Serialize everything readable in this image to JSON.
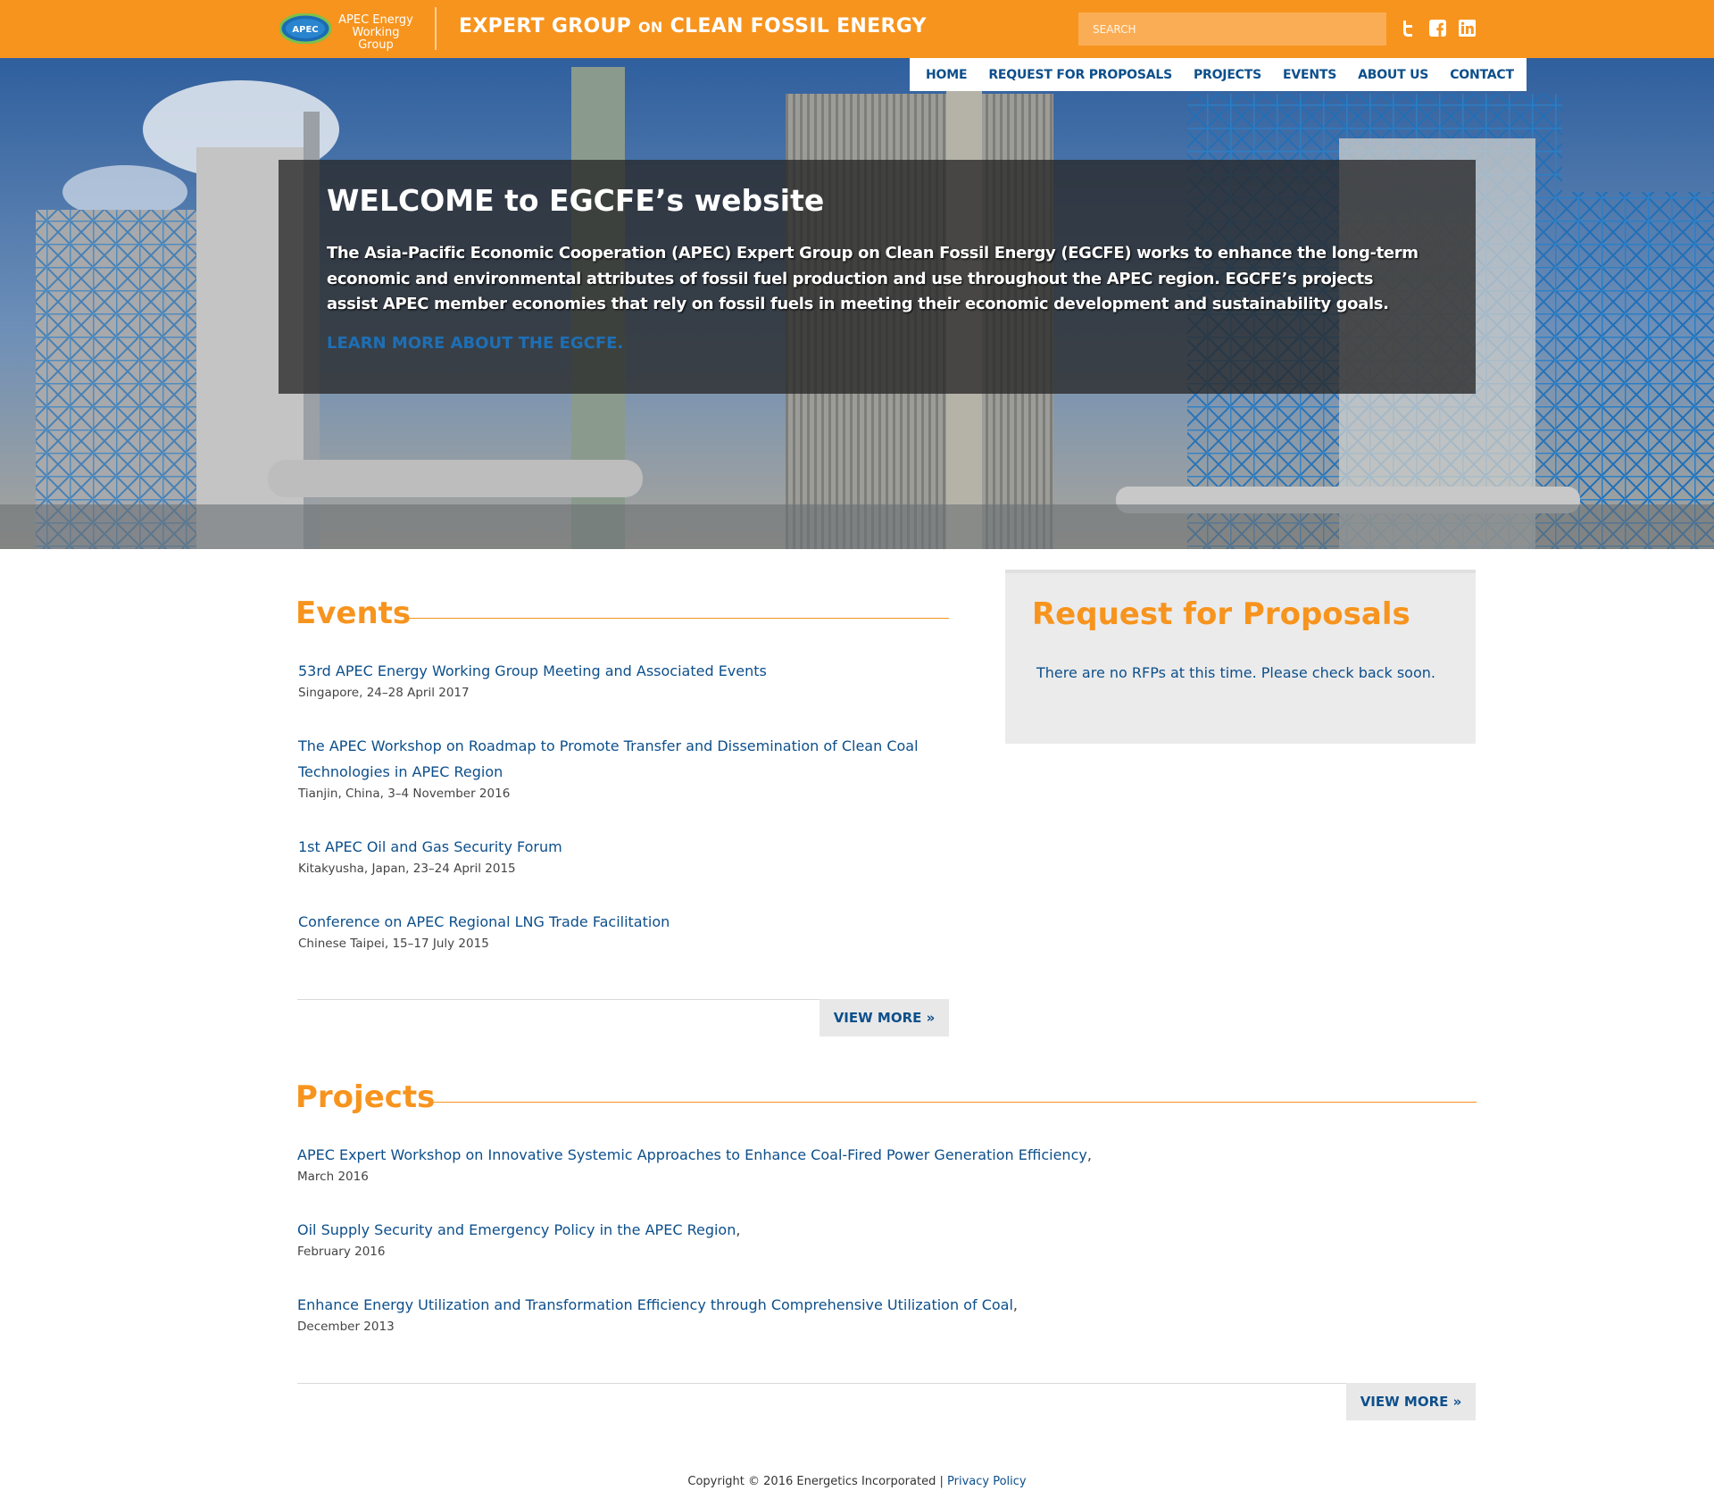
{
  "header": {
    "logo_badge": "APEC",
    "logo_line1": "APEC Energy",
    "logo_line2": "Working Group",
    "title_part1": "EXPERT GROUP",
    "title_on": "ON",
    "title_part2": "CLEAN FOSSIL ENERGY",
    "search_placeholder": "SEARCH",
    "social": [
      "twitter-icon",
      "facebook-icon",
      "linkedin-icon"
    ],
    "accent": "#f7941e"
  },
  "nav": {
    "items": [
      "HOME",
      "REQUEST FOR PROPOSALS",
      "PROJECTS",
      "EVENTS",
      "ABOUT US",
      "CONTACT"
    ]
  },
  "hero": {
    "heading": "WELCOME to EGCFE’s website",
    "body": "The Asia-Pacific Economic Cooperation (APEC) Expert Group on Clean Fossil Energy (EGCFE) works to enhance the long-term economic and environmental attributes of fossil fuel production and use throughout the APEC region. EGCFE’s projects assist APEC member economies that rely on fossil fuels in meeting their economic development and sustainability goals.",
    "learn_more": "LEARN MORE ABOUT THE EGCFE."
  },
  "events": {
    "title": "Events",
    "items": [
      {
        "title": "53rd APEC Energy Working Group Meeting and Associated Events",
        "meta": "Singapore, 24–28 April 2017"
      },
      {
        "title_line1": "The APEC Workshop on Roadmap to Promote Transfer and Dissemination of Clean Coal",
        "title_line2": "Technologies in APEC Region",
        "meta": "Tianjin, China, 3–4 November 2016"
      },
      {
        "title": "1st APEC Oil and Gas Security Forum",
        "meta": "Kitakyusha, Japan, 23–24 April 2015"
      },
      {
        "title": "Conference on APEC Regional LNG Trade Facilitation",
        "meta": "Chinese Taipei, 15–17 July 2015"
      }
    ],
    "view_more": "VIEW MORE »"
  },
  "rfp": {
    "title": "Request for Proposals",
    "message": "There are no RFPs at this time. Please check back soon."
  },
  "projects": {
    "title": "Projects",
    "items": [
      {
        "title": "APEC Expert Workshop on Innovative Systemic Approaches to Enhance Coal-Fired Power Generation Efficiency",
        "meta": "March 2016"
      },
      {
        "title": "Oil Supply Security and Emergency Policy in the APEC Region",
        "meta": "February 2016"
      },
      {
        "title": "Enhance Energy Utilization and Transformation Efficiency through Comprehensive Utilization of Coal",
        "meta": "December 2013"
      }
    ],
    "separator": ",",
    "view_more": "VIEW MORE »"
  },
  "footer": {
    "copyright": "Copyright © 2016 Energetics Incorporated",
    "divider": "|",
    "privacy": "Privacy Policy"
  }
}
